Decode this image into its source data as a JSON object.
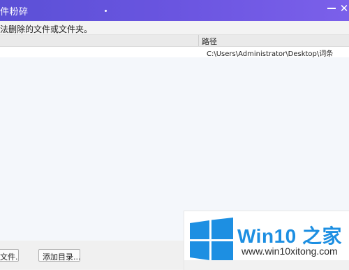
{
  "window": {
    "title": "件粉碎",
    "minimize_glyph": "",
    "close_glyph": "✕"
  },
  "description": "法删除的文件或文件夹。",
  "list": {
    "columns": [
      "",
      "路径"
    ],
    "rows": [
      {
        "path": "C:\\Users\\Administrator\\Desktop\\词条"
      }
    ]
  },
  "buttons": {
    "add_files": "文件...",
    "add_directory": "添加目录..."
  },
  "watermark": {
    "title": "Win10 之家",
    "url": "www.win10xitong.com",
    "colors": {
      "blue": "#1d8fe2"
    }
  },
  "colors": {
    "titlebar": "#6a55e0"
  }
}
